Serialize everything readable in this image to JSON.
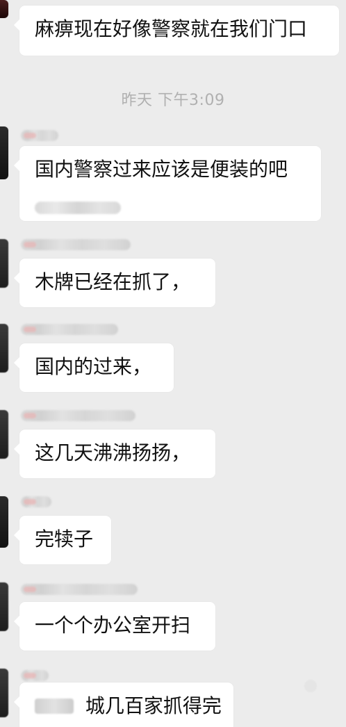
{
  "messages": [
    {
      "text": "麻痹现在好像警察就在我们门口"
    },
    {
      "text": "国内警察过来应该是便装的吧"
    },
    {
      "text": "木牌已经在抓了，"
    },
    {
      "text": "国内的过来，"
    },
    {
      "text": "这几天沸沸扬扬，"
    },
    {
      "text": "完犊子"
    },
    {
      "text": "一个个办公室开扫"
    },
    {
      "text": "城几百家抓得完"
    }
  ],
  "timestamp": "昨天 下午3:09"
}
